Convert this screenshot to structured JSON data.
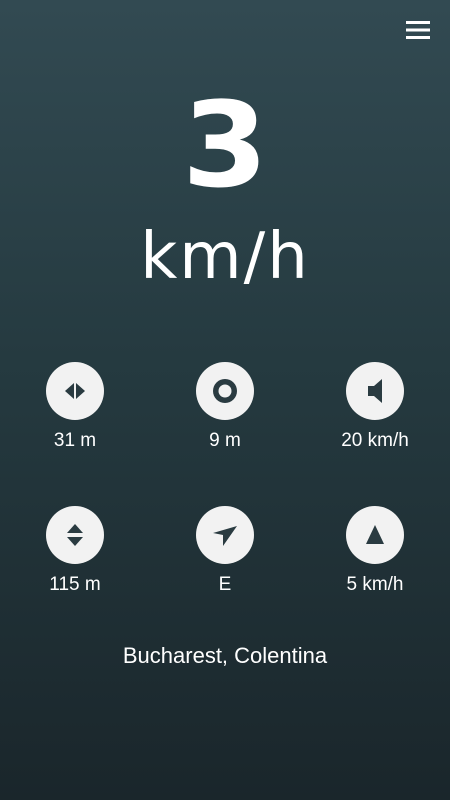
{
  "header": {
    "menu_icon": "hamburger-menu-icon"
  },
  "speedometer": {
    "speed": "3",
    "unit": "km/h"
  },
  "stats": {
    "distance": {
      "icon": "horizontal-arrows-icon",
      "value": "31 m"
    },
    "accuracy": {
      "icon": "target-circle-icon",
      "value": "9 m"
    },
    "speed_alert": {
      "icon": "speaker-icon",
      "value": "20 km/h"
    },
    "altitude": {
      "icon": "vertical-arrows-icon",
      "value": "115 m"
    },
    "heading": {
      "icon": "compass-arrow-icon",
      "value": "E"
    },
    "max_speed": {
      "icon": "triangle-up-icon",
      "value": "5 km/h"
    }
  },
  "location": {
    "text": "Bucharest, Colentina"
  },
  "colors": {
    "background_top": "#324a52",
    "background_bottom": "#1a262b",
    "circle": "#f2f2f2",
    "icon": "#2a3b41",
    "text": "#ffffff"
  }
}
